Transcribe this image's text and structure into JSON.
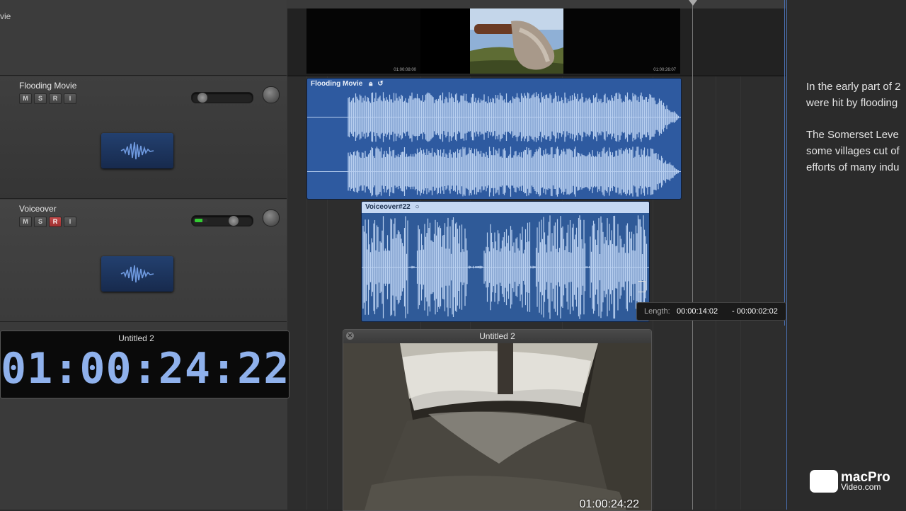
{
  "tracks": {
    "movie": {
      "name": "vie"
    },
    "flooding": {
      "name": "Flooding Movie",
      "buttons": [
        "M",
        "S",
        "R",
        "I"
      ],
      "record_armed": false
    },
    "voiceover": {
      "name": "Voiceover",
      "buttons": [
        "M",
        "S",
        "R",
        "I"
      ],
      "record_armed": true
    }
  },
  "timeline": {
    "thumb_timecodes": [
      "01:00:08:00",
      "01:00:26:07"
    ],
    "regions": [
      {
        "name": "Flooding Movie",
        "icons": [
          "lock-icon",
          "loop-icon"
        ]
      },
      {
        "name": "Voiceover#22",
        "icons": [
          "loop-icon"
        ]
      }
    ],
    "tooltip": {
      "label": "Length:",
      "length": "00:00:14:02",
      "delta": "- 00:00:02:02"
    }
  },
  "lcd": {
    "title": "Untitled 2",
    "time": "01:00:24:22"
  },
  "movie_window": {
    "title": "Untitled 2",
    "timecode": "01:00:24:22"
  },
  "notes": {
    "line1": "In the early part of 2",
    "line2": "were hit by flooding",
    "line3": "The Somerset Leve",
    "line4": "some villages cut of",
    "line5": "efforts of many indu"
  },
  "branding": {
    "line1": "macPro",
    "line2": "Video.com"
  },
  "colors": {
    "region_blue": "#2e5aa0",
    "waveform": "#b9d0f0",
    "lcd_text": "#8fb1ec",
    "record": "#c34a4a"
  }
}
